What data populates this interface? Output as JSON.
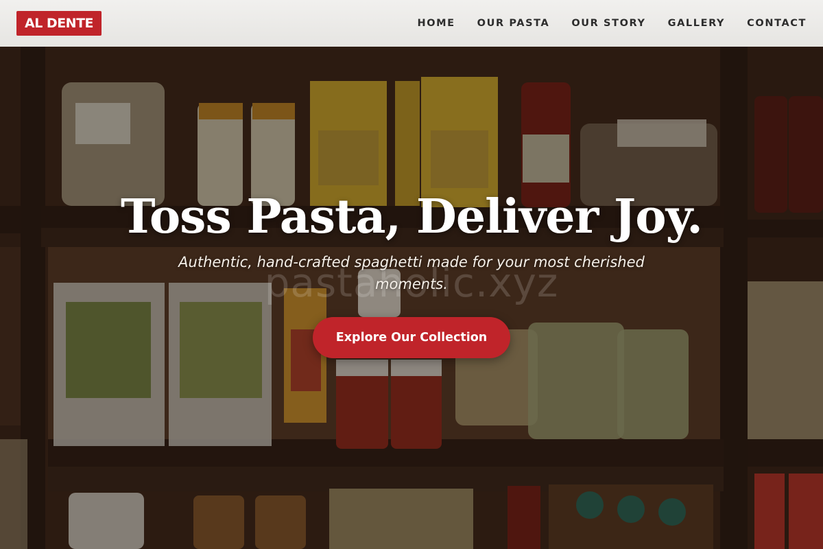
{
  "header": {
    "logo_text": "AL DENTE",
    "nav": [
      {
        "label": "HOME"
      },
      {
        "label": "OUR PASTA"
      },
      {
        "label": "OUR STORY"
      },
      {
        "label": "GALLERY"
      },
      {
        "label": "CONTACT"
      }
    ]
  },
  "hero": {
    "headline": "Toss Pasta, Deliver Joy.",
    "subheadline": "Authentic, hand-crafted spaghetti made for your most cherished moments.",
    "watermark": "pastaholic.xyz",
    "cta_label": "Explore Our Collection",
    "background_description_icon": "pantry-shelves-photo"
  },
  "colors": {
    "brand_red": "#c0242a",
    "header_bg": "#eceae7",
    "nav_text": "#2d2d2d",
    "hero_text": "#ffffff"
  }
}
